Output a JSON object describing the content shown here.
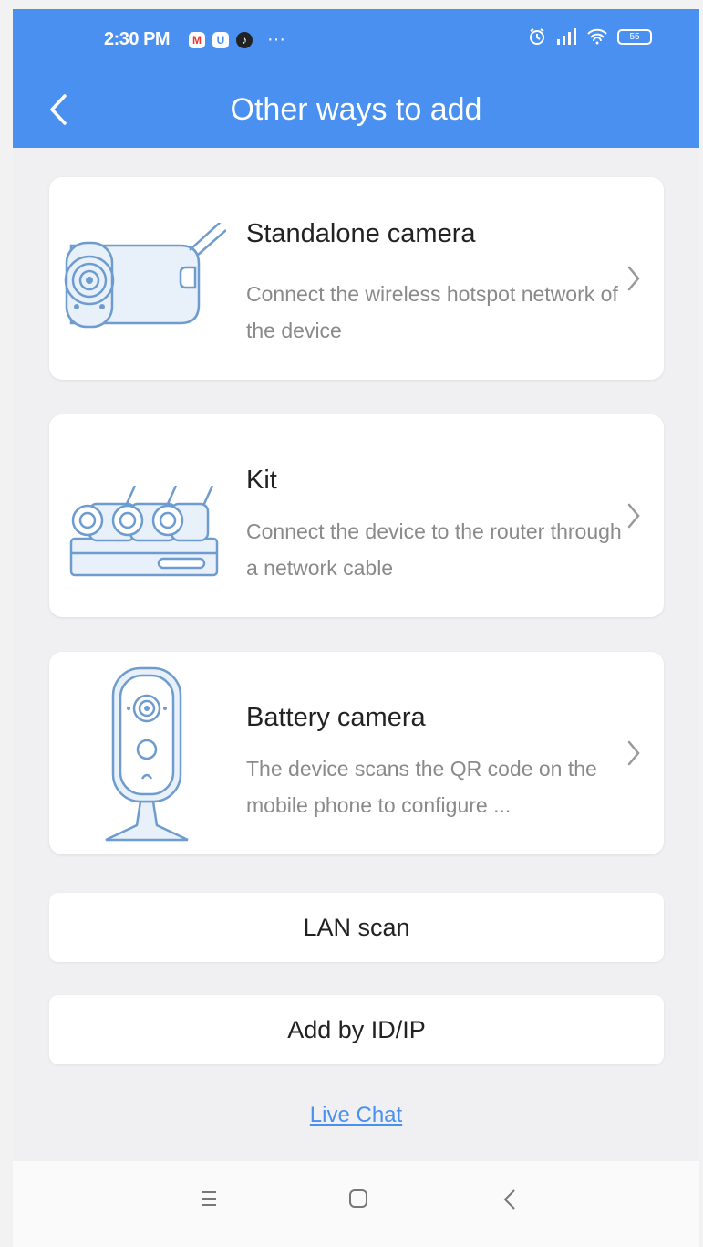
{
  "status_bar": {
    "time": "2:30 PM",
    "app_badges": [
      "M",
      "U",
      "♪"
    ],
    "more": "···",
    "battery": "55"
  },
  "header": {
    "title": "Other ways to add",
    "back_icon": "chevron-left-icon"
  },
  "options": [
    {
      "title": "Standalone camera",
      "description": "Connect the wireless hotspot network of the device",
      "image": "standalone-camera-icon"
    },
    {
      "title": "Kit",
      "description": "Connect the device to the router through a network cable",
      "image": "kit-nvr-icon"
    },
    {
      "title": "Battery camera",
      "description": "The device scans the QR code on the mobile phone to configure ...",
      "image": "battery-camera-icon"
    }
  ],
  "buttons": {
    "lan_scan": "LAN scan",
    "add_by_id_ip": "Add by ID/IP"
  },
  "live_chat": "Live Chat",
  "system_nav": [
    "menu-icon",
    "home-icon",
    "back-icon"
  ],
  "colors": {
    "accent": "#4a90f0",
    "background": "#f0f0f2",
    "card": "#ffffff",
    "secondary_text": "#8a8a8a",
    "illustration": "#6e9ccf"
  }
}
